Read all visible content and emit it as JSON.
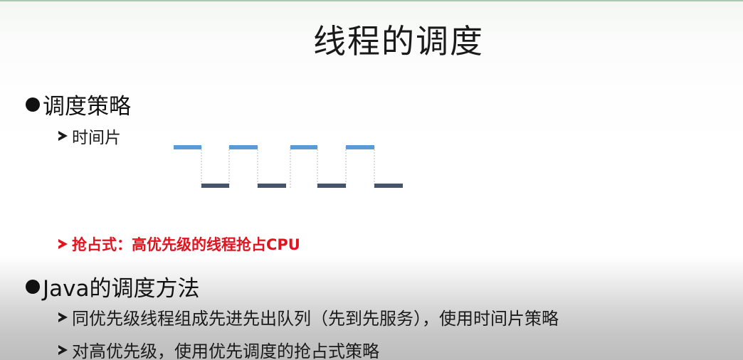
{
  "slide": {
    "title": "线程的调度",
    "section1": {
      "heading": "调度策略",
      "item_time_slice": "时间片",
      "item_preemptive": "抢占式：高优先级的线程抢占CPU"
    },
    "section2": {
      "heading": "Java的调度方法",
      "item_fifo": "同优先级线程组成先进先出队列（先到先服务），使用时间片策略",
      "item_high_priority": "对高优先级，使用优先调度的抢占式策略"
    }
  },
  "colors": {
    "high_level": "#5b9bd5",
    "low_level": "#44546a",
    "accent_red": "#e0141e"
  }
}
